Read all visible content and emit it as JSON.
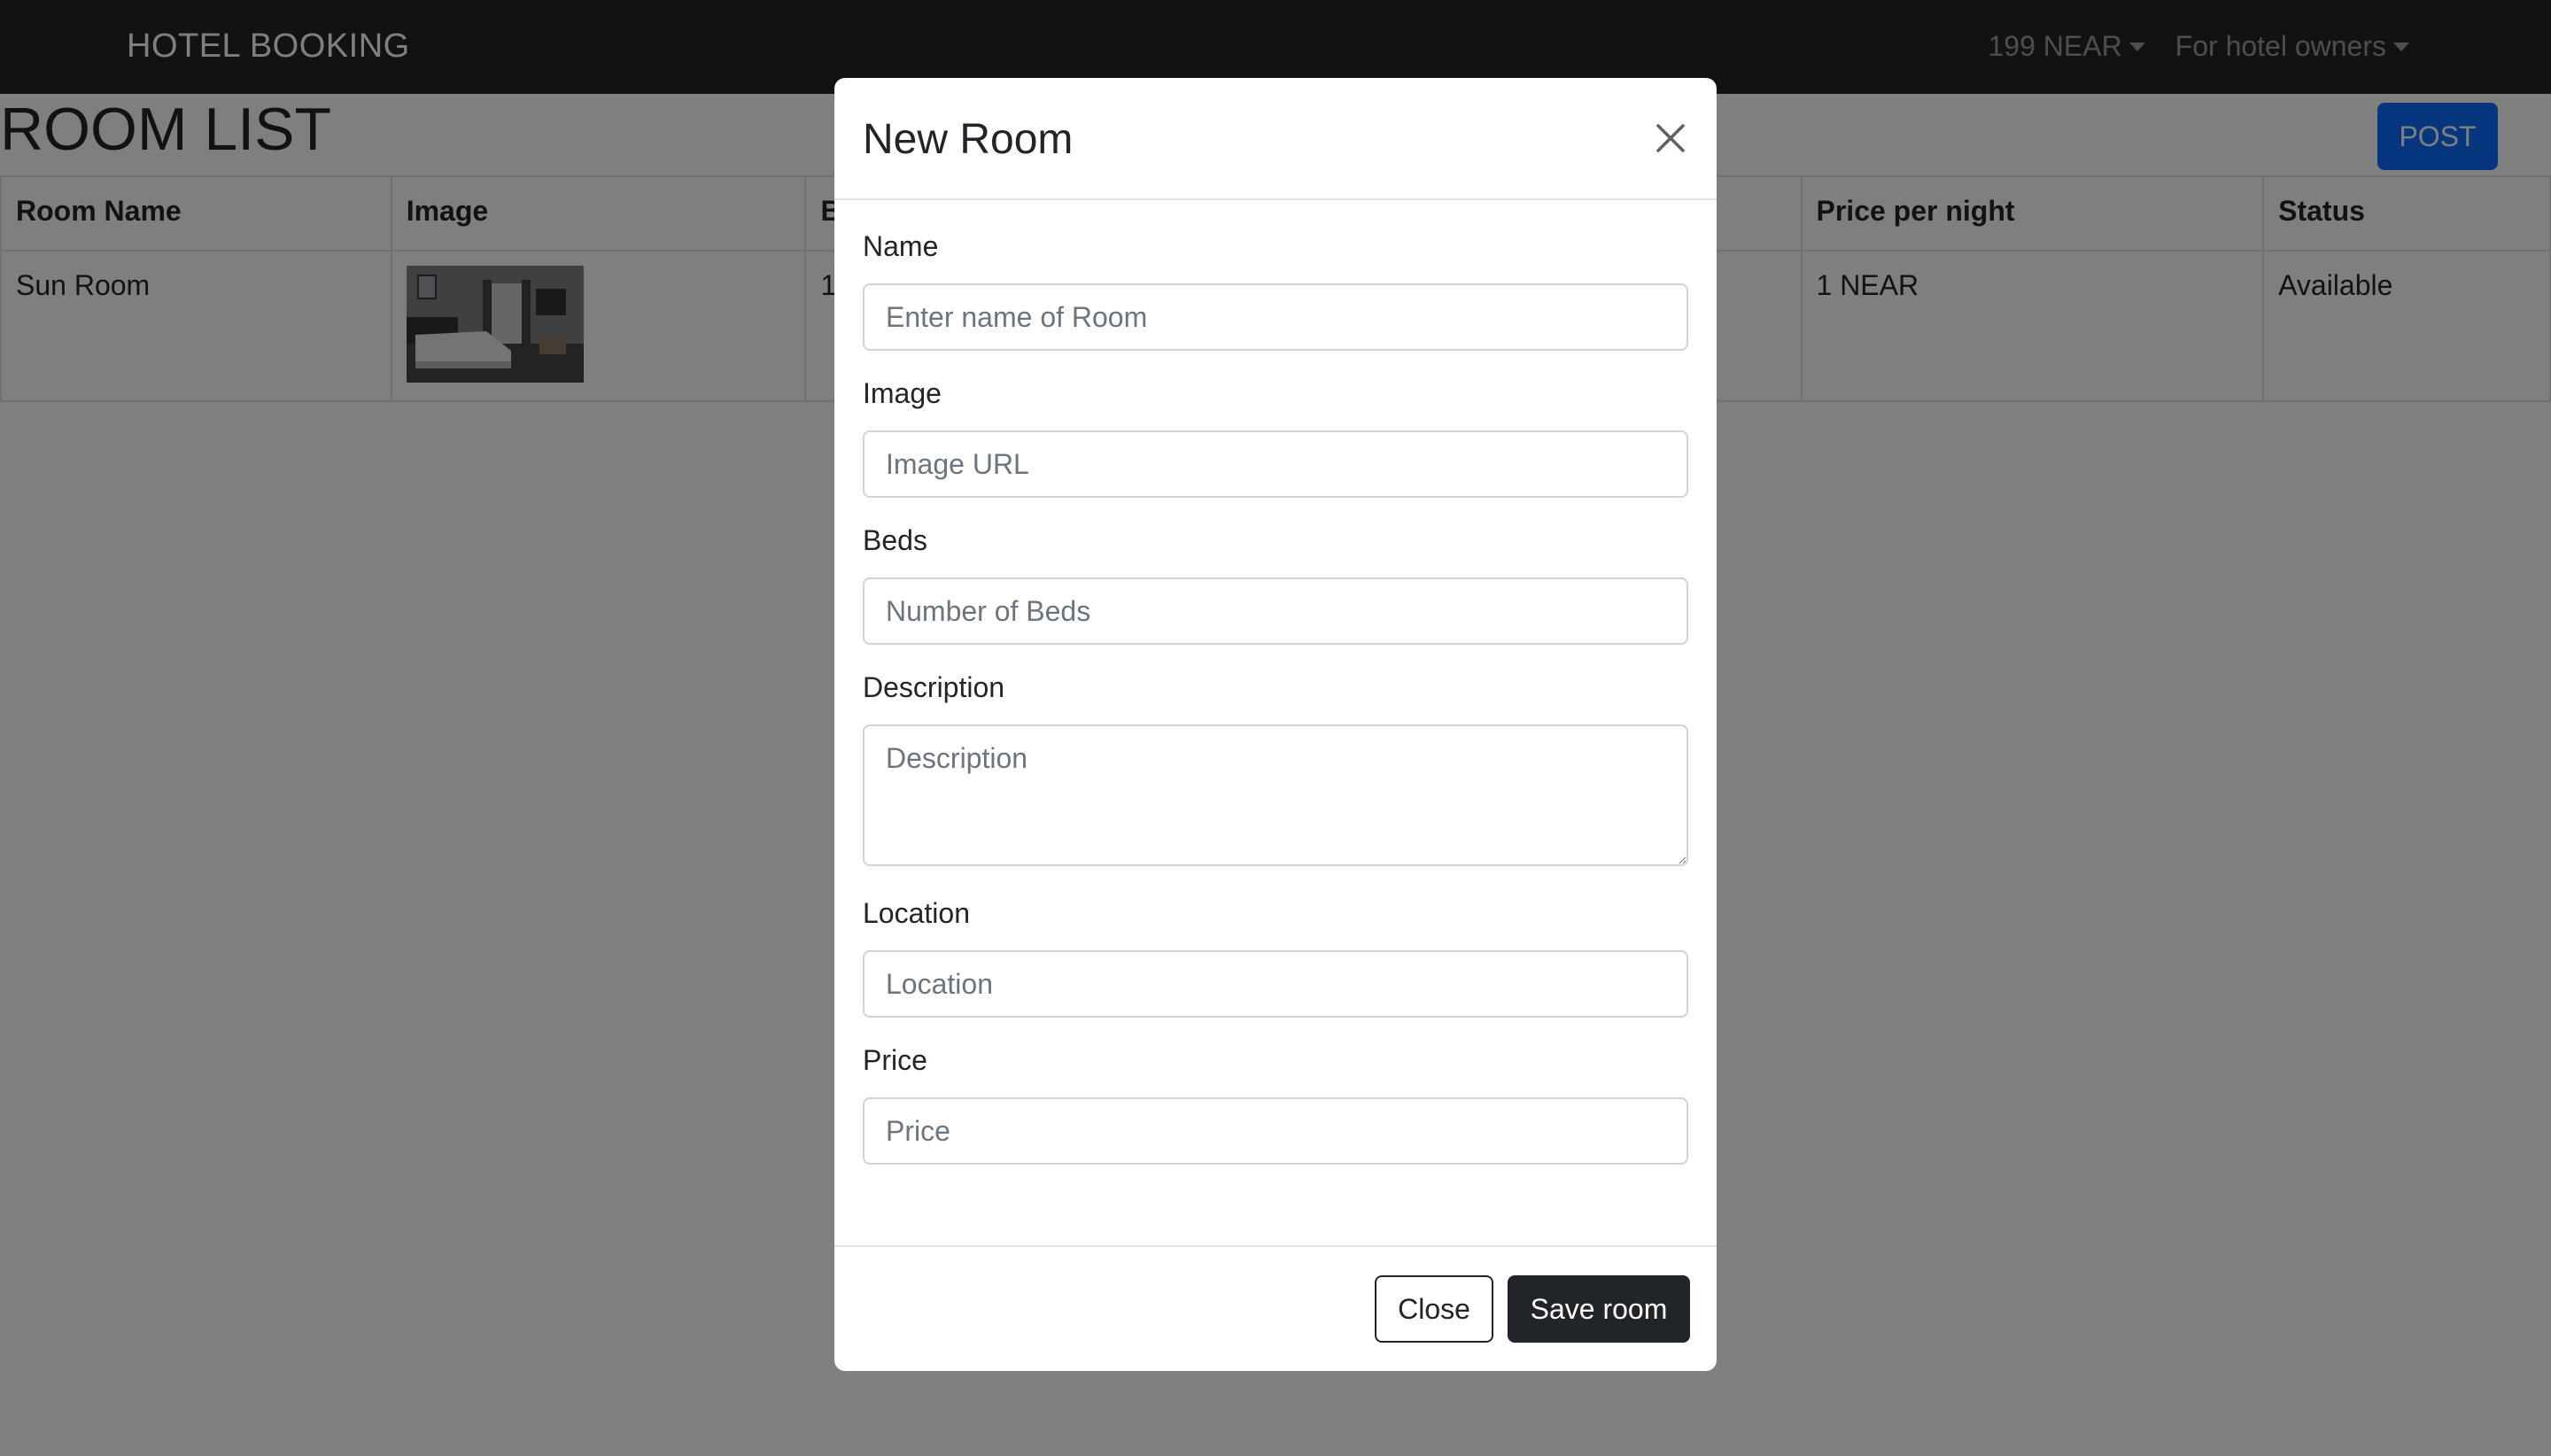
{
  "navbar": {
    "brand": "HOTEL BOOKING",
    "account_menu": "199 NEAR",
    "owners_menu": "For hotel owners"
  },
  "page": {
    "title": "ROOM LIST",
    "post_button": "POST"
  },
  "table": {
    "headers": [
      "Room Name",
      "Image",
      "B",
      "Price per night",
      "Status"
    ],
    "rows": [
      {
        "room_name": "Sun Room",
        "image": "hotel-room-thumbnail",
        "beds": "1",
        "price": "1 NEAR",
        "status": "Available"
      }
    ]
  },
  "modal": {
    "title": "New Room",
    "close_icon": "close-icon",
    "fields": [
      {
        "label": "Name",
        "placeholder": "Enter name of Room",
        "value": ""
      },
      {
        "label": "Image",
        "placeholder": "Image URL",
        "value": ""
      },
      {
        "label": "Beds",
        "placeholder": "Number of Beds",
        "value": ""
      },
      {
        "label": "Description",
        "placeholder": "Description",
        "value": ""
      },
      {
        "label": "Location",
        "placeholder": "Location",
        "value": ""
      },
      {
        "label": "Price",
        "placeholder": "Price",
        "value": ""
      }
    ],
    "close_button": "Close",
    "save_button": "Save room"
  },
  "colors": {
    "navbar_bg": "#212529",
    "primary": "#0d6efd",
    "dark_button": "#212529",
    "backdrop": "rgba(0,0,0,0.5)"
  }
}
